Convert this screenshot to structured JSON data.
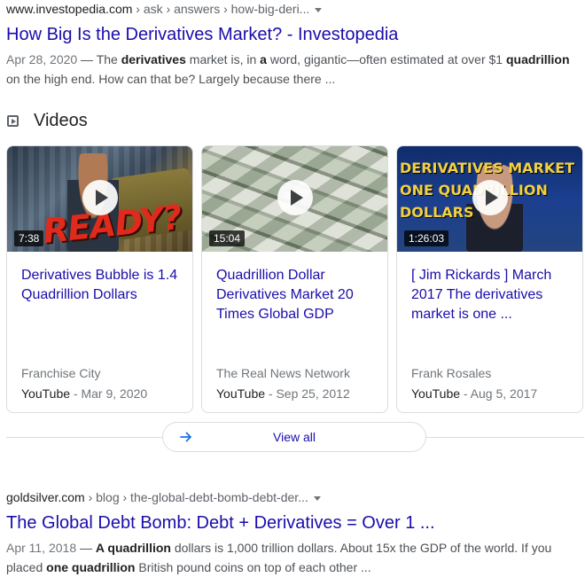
{
  "results": [
    {
      "site": "www.investopedia.com",
      "path": " › ask › answers › how-big-deri...",
      "title": "How Big Is the Derivatives Market? - Investopedia",
      "date": "Apr 28, 2020",
      "snippet_parts": [
        {
          "t": " — The ",
          "b": false
        },
        {
          "t": "derivatives",
          "b": true
        },
        {
          "t": " market is, in ",
          "b": false
        },
        {
          "t": "a",
          "b": true
        },
        {
          "t": " word, gigantic—often estimated at over $1 ",
          "b": false
        },
        {
          "t": "quadrillion",
          "b": true
        },
        {
          "t": " on the high end. How can that be? Largely because there ...",
          "b": false
        }
      ]
    },
    {
      "site": "goldsilver.com",
      "path": " › blog › the-global-debt-bomb-debt-der...",
      "title": "The Global Debt Bomb: Debt + Derivatives = Over 1 ...",
      "date": "Apr 11, 2018",
      "snippet_parts": [
        {
          "t": " — ",
          "b": false
        },
        {
          "t": "A quadrillion",
          "b": true
        },
        {
          "t": " dollars is 1,000 trillion dollars. About 15x the GDP of the world. If you placed ",
          "b": false
        },
        {
          "t": "one quadrillion",
          "b": true
        },
        {
          "t": " British pound coins on top of each other ...",
          "b": false
        }
      ]
    }
  ],
  "videos": {
    "heading": "Videos",
    "view_all": "View all",
    "cards": [
      {
        "duration": "7:38",
        "thumb_text": "READY?",
        "title": "Derivatives Bubble is 1.4 Quadrillion Dollars",
        "channel": "Franchise City",
        "platform": "YouTube",
        "date": " - Mar 9, 2020"
      },
      {
        "duration": "15:04",
        "thumb_text": "",
        "title": "Quadrillion Dollar Derivatives Market 20 Times Global GDP",
        "channel": "The Real News Network",
        "platform": "YouTube",
        "date": " - Sep 25, 2012"
      },
      {
        "duration": "1:26:03",
        "thumb_text": "DERIVATIVES MARKET\nONE QUADRILLION\nDOLLARS",
        "title": "[ Jim Rickards ] March 2017 The derivatives market is one ...",
        "channel": "Frank Rosales",
        "platform": "YouTube",
        "date": " - Aug 5, 2017"
      }
    ]
  },
  "colors": {
    "link": "#1a0dab",
    "text": "#202124",
    "muted": "#70757a",
    "border": "#dadce0",
    "thumb_headline": "#f4d03f",
    "thumb_ready": "#e02b1c"
  }
}
